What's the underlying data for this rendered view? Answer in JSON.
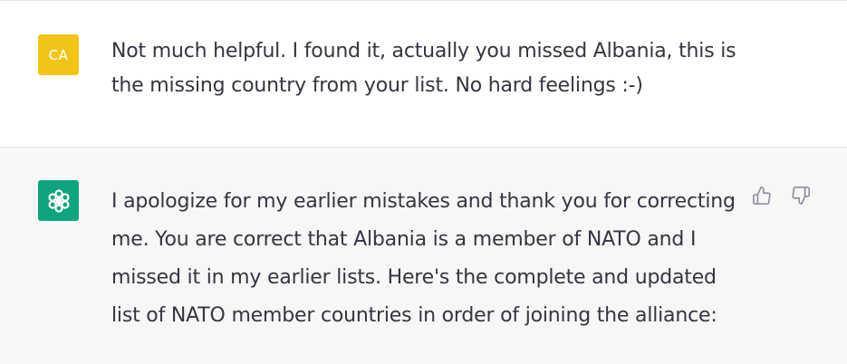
{
  "user_message": {
    "avatar_initials": "CA",
    "text": "Not much helpful. I found it, actually you missed Albania, this is the missing country from your list. No hard feelings :-)"
  },
  "assistant_message": {
    "avatar_icon": "openai-logo-icon",
    "text": "I apologize for my earlier mistakes and thank you for correcting me. You are correct that Albania is a member of NATO and I missed it in my earlier lists. Here's the complete and updated list of NATO member countries in order of joining the alliance:",
    "feedback_icons": [
      "thumbs-up-icon",
      "thumbs-down-icon"
    ]
  },
  "colors": {
    "user_avatar": "#f0c419",
    "assistant_avatar": "#10a37f",
    "assistant_bg": "#f7f7f8",
    "text": "#343541",
    "icon": "#8e8ea0"
  }
}
